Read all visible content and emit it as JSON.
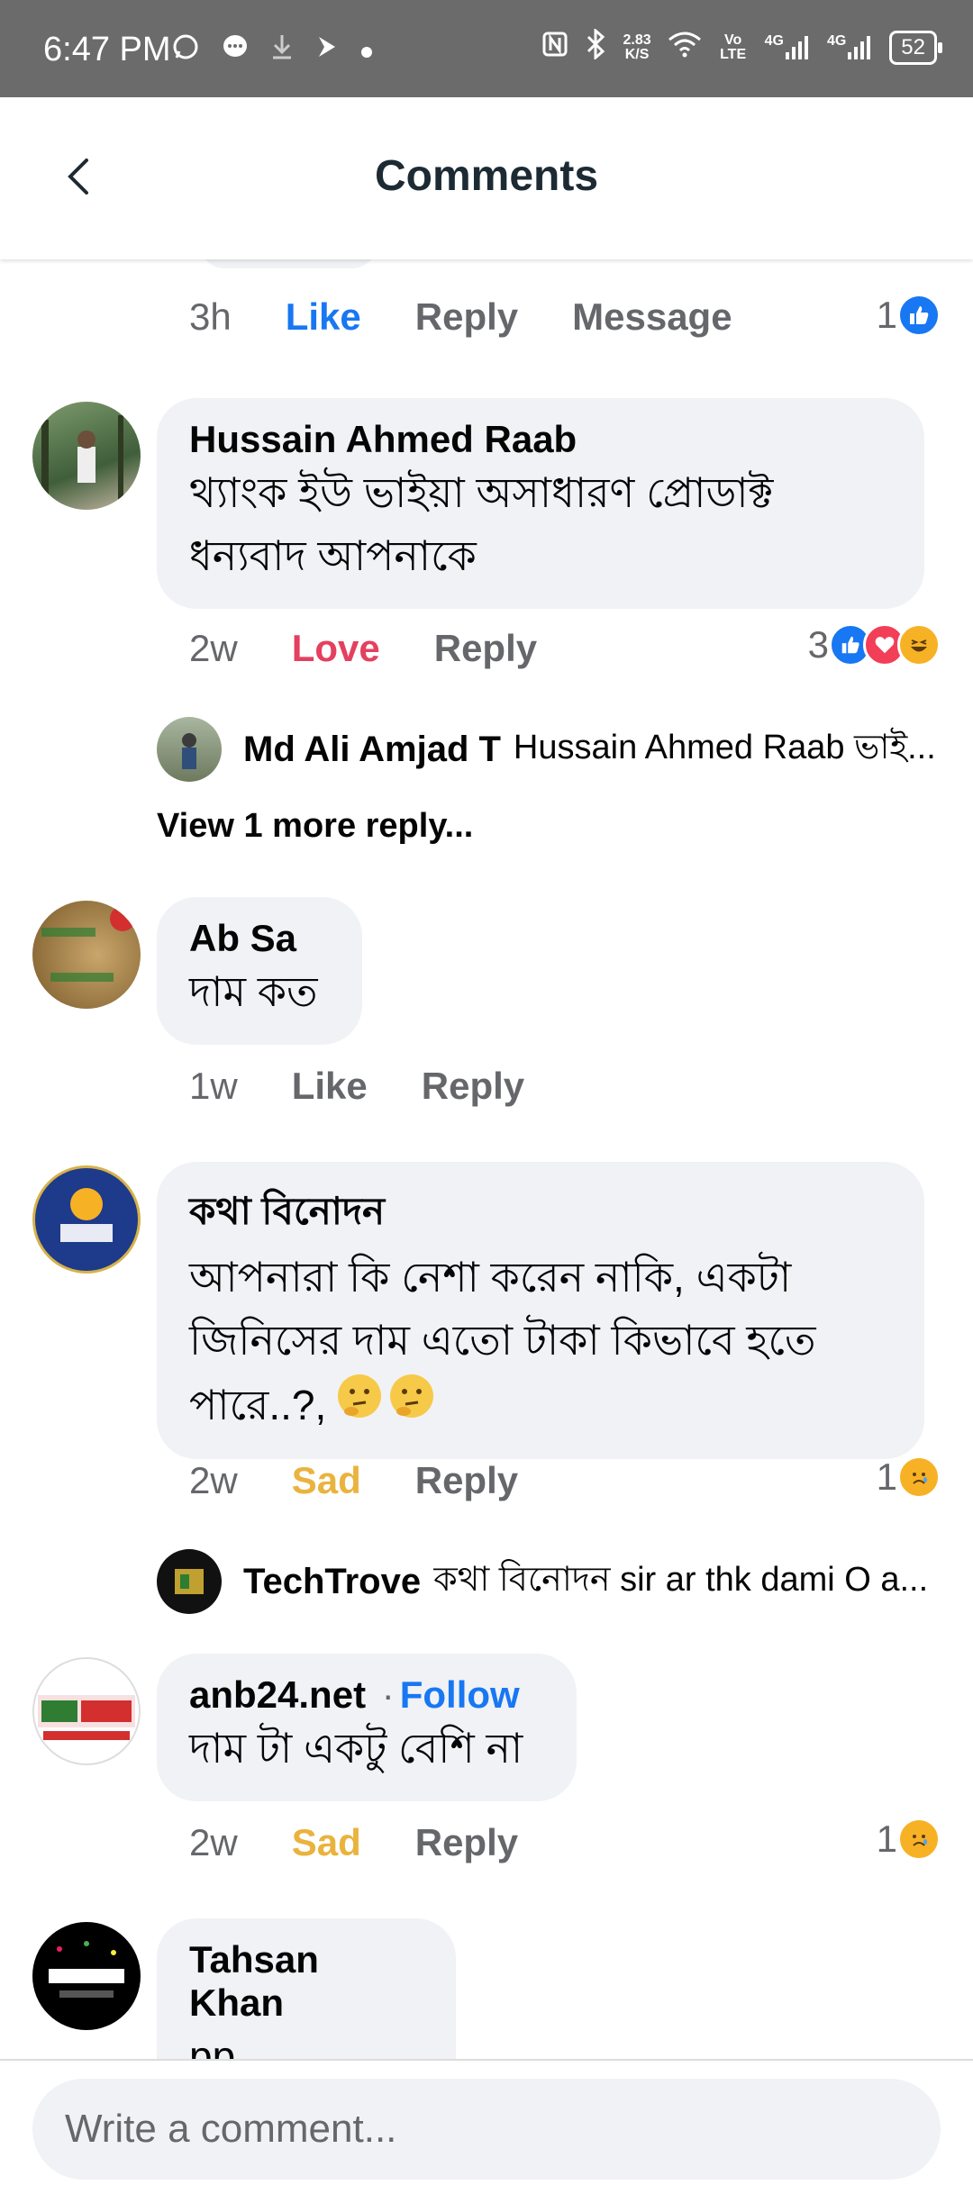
{
  "status_bar": {
    "time": "6:47 PM",
    "net_speed_top": "2.83",
    "net_speed_bottom": "K/S",
    "volte": "Vo LTE",
    "signal1": "4G",
    "signal2": "4G",
    "battery": "52"
  },
  "header": {
    "title": "Comments"
  },
  "top_row": {
    "time": "3h",
    "like": "Like",
    "reply": "Reply",
    "message": "Message",
    "count": "1"
  },
  "comments": [
    {
      "author": "Hussain Ahmed Raab",
      "line1": "থ্যাংক ইউ ভাইয়া অসাধারণ প্রোডাক্ট",
      "line2": "ধন্যবাদ আপনাকে",
      "time": "2w",
      "reaction_label": "Love",
      "reply": "Reply",
      "count": "3",
      "reply_preview": {
        "author": "Md Ali Amjad T",
        "text": "Hussain Ahmed Raab ভাই..."
      },
      "view_more": "View 1 more reply..."
    },
    {
      "author": "Ab Sa",
      "line1": "দাম কত",
      "time": "1w",
      "reaction_label": "Like",
      "reply": "Reply"
    },
    {
      "author": "কথা বিনোদন",
      "line1": "আপনারা কি নেশা করেন নাকি, একটা",
      "line2": "জিনিসের দাম এতো টাকা কিভাবে হতে",
      "line3": "পারে..?,",
      "time": "2w",
      "reaction_label": "Sad",
      "reply": "Reply",
      "count": "1",
      "reply_preview": {
        "author": "TechTrove",
        "text": "কথা বিনোদন sir ar thk dami O a..."
      }
    },
    {
      "author": "anb24.net",
      "follow_dot": "·",
      "follow": "Follow",
      "line1": "দাম টা একটু বেশি না",
      "time": "2w",
      "reaction_label": "Sad",
      "reply": "Reply",
      "count": "1"
    },
    {
      "author": "Tahsan Khan",
      "line1": "pp"
    }
  ],
  "composer": {
    "placeholder": "Write a comment..."
  },
  "colors": {
    "like": "#1877f2",
    "love": "#e4405f",
    "sad": "#e9b33d",
    "bubble": "#f0f2f5",
    "muted": "#65676b"
  }
}
